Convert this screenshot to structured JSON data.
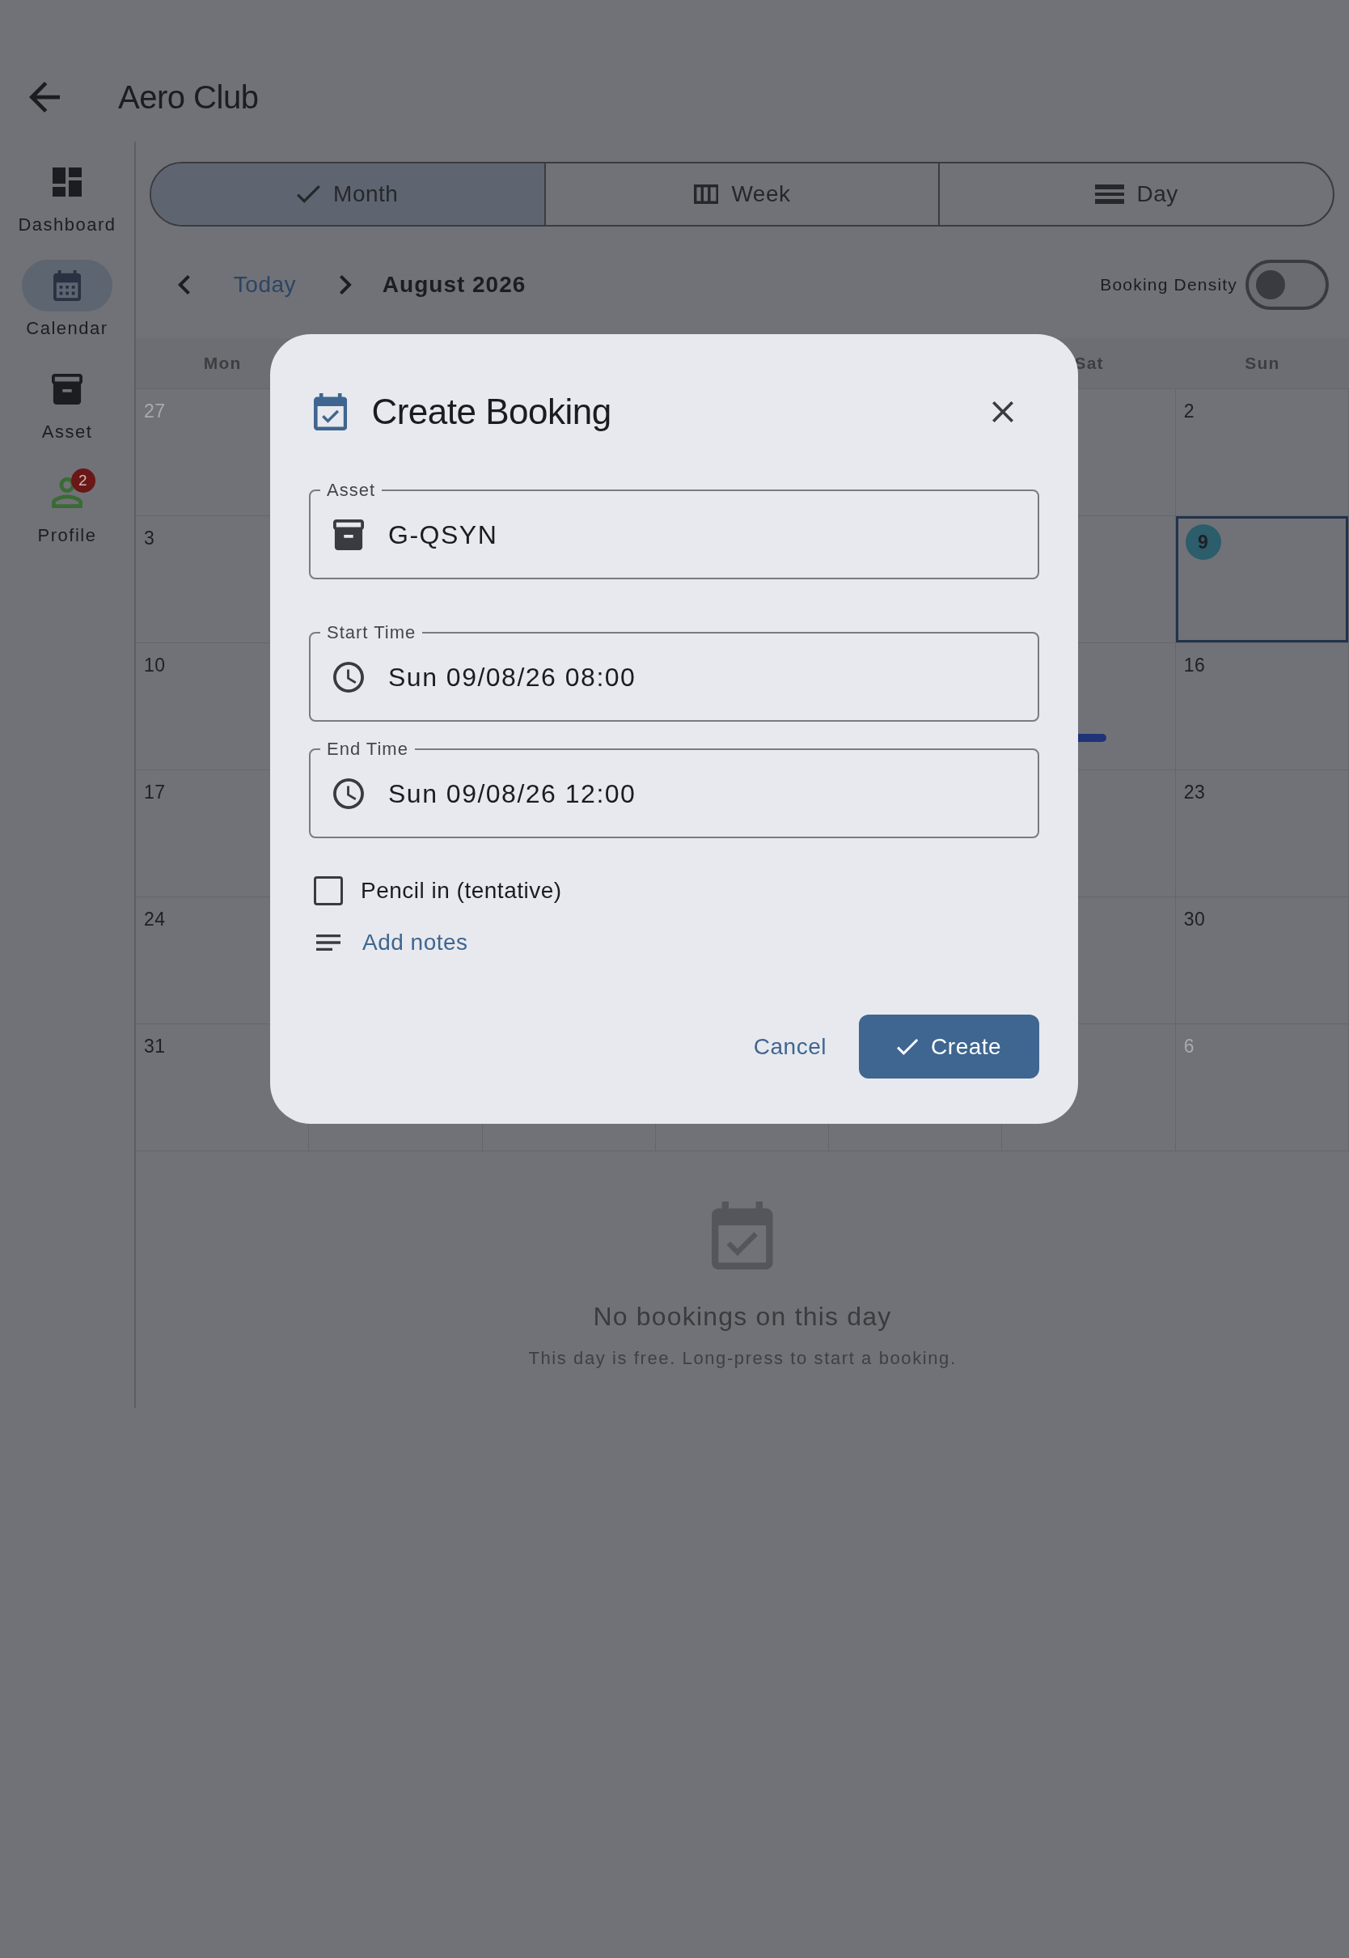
{
  "app_bar": {
    "title": "Aero Club"
  },
  "sidebar": {
    "items": [
      {
        "kind": "dashboard",
        "label": "Dashboard",
        "selected": false
      },
      {
        "kind": "calendar",
        "label": "Calendar",
        "selected": true
      },
      {
        "kind": "asset",
        "label": "Asset",
        "selected": false
      },
      {
        "kind": "profile",
        "label": "Profile",
        "selected": false,
        "badge": "2"
      }
    ]
  },
  "view_tabs": [
    {
      "kind": "month",
      "label": "Month",
      "selected": true
    },
    {
      "kind": "week",
      "label": "Week",
      "selected": false
    },
    {
      "kind": "day",
      "label": "Day",
      "selected": false
    }
  ],
  "month_nav": {
    "today": "Today",
    "title": "August 2026"
  },
  "booking_density": {
    "label": "Booking Density",
    "on": false
  },
  "calendar": {
    "weekdays": {
      "mon": "Mon",
      "sat": "Sat",
      "sun": "Sun"
    },
    "weeks": [
      {
        "cells": [
          {
            "day": "27",
            "muted": true,
            "selected": false
          },
          {},
          {},
          {},
          {},
          {},
          {
            "day": "2",
            "muted": false,
            "selected": false
          }
        ]
      },
      {
        "cells": [
          {
            "day": "3",
            "muted": false,
            "selected": false
          },
          {},
          {},
          {},
          {},
          {},
          {
            "day": "9",
            "muted": false,
            "selected": true
          }
        ]
      },
      {
        "cells": [
          {
            "day": "10",
            "muted": false,
            "selected": false
          },
          {},
          {},
          {},
          {},
          {
            "has_booking": true
          },
          {
            "day": "16",
            "muted": false,
            "selected": false
          }
        ]
      },
      {
        "cells": [
          {
            "day": "17",
            "muted": false,
            "selected": false
          },
          {},
          {},
          {},
          {},
          {},
          {
            "day": "23",
            "muted": false,
            "selected": false
          }
        ]
      },
      {
        "cells": [
          {
            "day": "24",
            "muted": false,
            "selected": false
          },
          {},
          {},
          {},
          {},
          {},
          {
            "day": "30",
            "muted": false,
            "selected": false
          }
        ]
      },
      {
        "cells": [
          {
            "day": "31",
            "muted": false,
            "selected": false
          },
          {},
          {},
          {},
          {},
          {},
          {
            "day": "6",
            "muted": true,
            "selected": false
          }
        ]
      }
    ]
  },
  "empty_state": {
    "title": "No bookings on this day",
    "message": "This day is free. Long-press to start a booking."
  },
  "dialog": {
    "title": "Create Booking",
    "fields": [
      {
        "kind": "asset",
        "label": "Asset",
        "value": "G-QSYN"
      },
      {
        "kind": "time",
        "label": "Start Time",
        "value": "Sun 09/08/26 08:00"
      },
      {
        "kind": "time",
        "label": "End Time",
        "value": "Sun 09/08/26 12:00"
      }
    ],
    "tentative": {
      "label": "Pencil in (tentative)",
      "checked": false
    },
    "notes_link": "Add notes",
    "buttons": [
      {
        "kind": "text",
        "label": "Cancel"
      },
      {
        "kind": "filled",
        "label": "Create"
      }
    ]
  }
}
